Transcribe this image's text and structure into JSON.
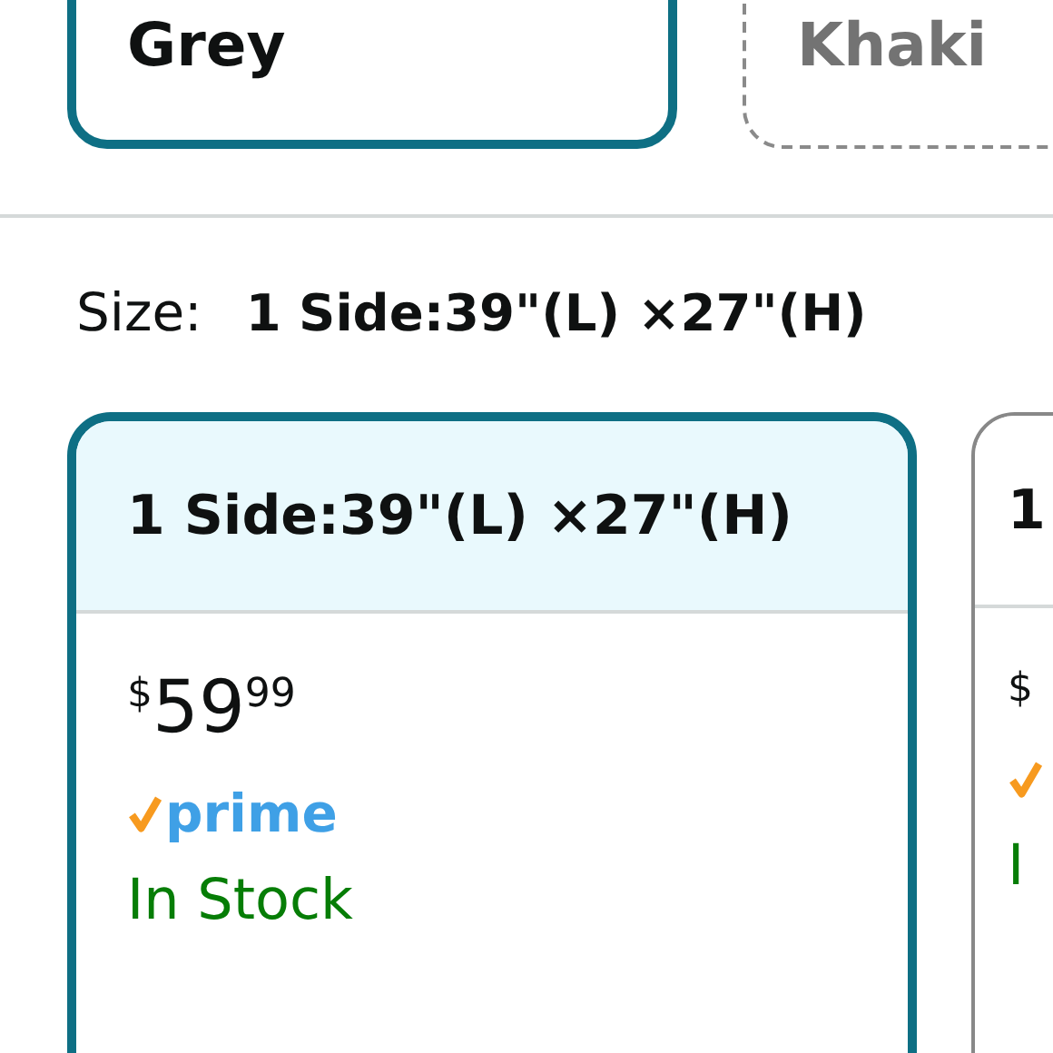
{
  "colors": [
    {
      "label": "Grey",
      "selected": true,
      "available": true
    },
    {
      "label": "Khaki",
      "selected": false,
      "available": false
    }
  ],
  "size": {
    "label": "Size:",
    "value": "1 Side:39\"(L) ×27\"(H)"
  },
  "size_options": [
    {
      "title": "1 Side:39\"(L) ×27\"(H)",
      "selected": true,
      "price": {
        "symbol": "$",
        "whole": "59",
        "fraction": "99"
      },
      "prime": true,
      "prime_text": "prime",
      "stock": "In Stock"
    },
    {
      "title": "1",
      "selected": false,
      "price": {
        "symbol": "$"
      },
      "prime": true,
      "stock": "I"
    }
  ]
}
